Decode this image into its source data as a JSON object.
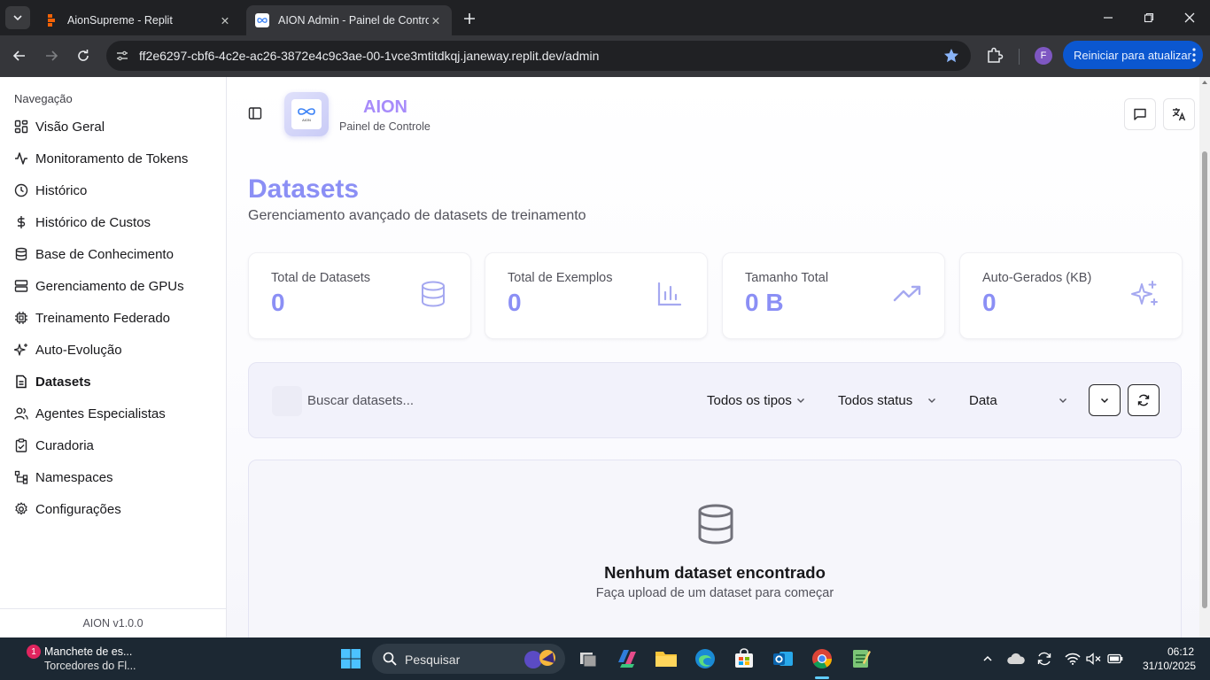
{
  "browser": {
    "tabs": [
      {
        "title": "AionSupreme - Replit",
        "active": false
      },
      {
        "title": "AION Admin - Painel de Controle",
        "active": true
      }
    ],
    "url": "ff2e6297-cbf6-4c2e-ac26-3872e4c9c3ae-00-1vce3mtitdkqj.janeway.replit.dev/admin",
    "profile_initial": "F",
    "update_button": "Reiniciar para atualizar"
  },
  "sidebar": {
    "group_label": "Navegação",
    "items": [
      {
        "label": "Visão Geral",
        "icon": "grid-icon"
      },
      {
        "label": "Monitoramento de Tokens",
        "icon": "activity-icon"
      },
      {
        "label": "Histórico",
        "icon": "clock-icon"
      },
      {
        "label": "Histórico de Custos",
        "icon": "dollar-icon"
      },
      {
        "label": "Base de Conhecimento",
        "icon": "database-icon"
      },
      {
        "label": "Gerenciamento de GPUs",
        "icon": "server-icon"
      },
      {
        "label": "Treinamento Federado",
        "icon": "cpu-icon"
      },
      {
        "label": "Auto-Evolução",
        "icon": "sparkles-icon"
      },
      {
        "label": "Datasets",
        "icon": "file-icon"
      },
      {
        "label": "Agentes Especialistas",
        "icon": "users-icon"
      },
      {
        "label": "Curadoria",
        "icon": "clipboard-check-icon"
      },
      {
        "label": "Namespaces",
        "icon": "network-icon"
      },
      {
        "label": "Configurações",
        "icon": "settings-icon"
      }
    ],
    "active_item": "Datasets",
    "version": "AION v1.0.0"
  },
  "header": {
    "logo_text": "AION",
    "brand": "AION",
    "subtitle": "Painel de Controle"
  },
  "page": {
    "title": "Datasets",
    "subtitle": "Gerenciamento avançado de datasets de treinamento"
  },
  "stats": [
    {
      "label": "Total de Datasets",
      "value": "0",
      "icon": "database-icon"
    },
    {
      "label": "Total de Exemplos",
      "value": "0",
      "icon": "bar-chart-icon"
    },
    {
      "label": "Tamanho Total",
      "value": "0 B",
      "icon": "trending-up-icon"
    },
    {
      "label": "Auto-Gerados (KB)",
      "value": "0",
      "icon": "sparkles-icon"
    }
  ],
  "filters": {
    "search_placeholder": "Buscar datasets...",
    "type_select": "Todos os tipos",
    "status_select": "Todos status",
    "sort_select": "Data"
  },
  "empty_state": {
    "title": "Nenhum dataset encontrado",
    "subtitle": "Faça upload de um dataset para começar"
  },
  "taskbar": {
    "news_badge": "1",
    "news_line1": "Manchete de es...",
    "news_line2": "Torcedores do Fl...",
    "search_placeholder": "Pesquisar",
    "time": "06:12",
    "date": "31/10/2025"
  },
  "colors": {
    "accent": "#8b8ff5",
    "brand": "#a78bfa",
    "browser_dark": "#202124",
    "update_blue": "#0b57d0"
  }
}
